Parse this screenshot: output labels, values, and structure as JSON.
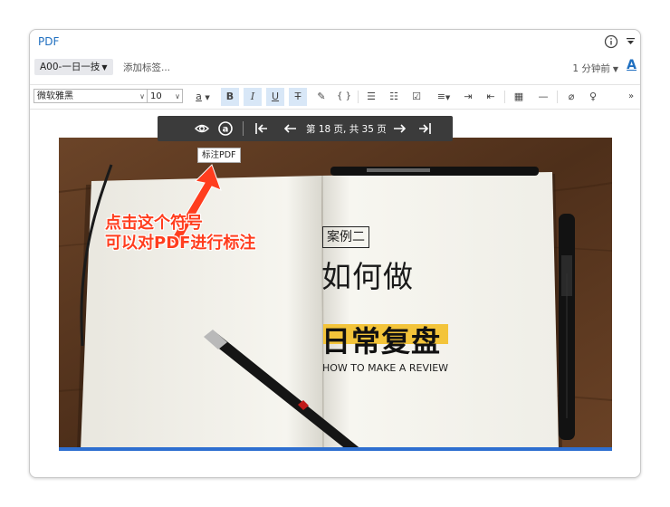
{
  "window": {
    "title": "PDF"
  },
  "tagbar": {
    "notebook": "A00-一日一技",
    "add_tag": "添加标签...",
    "time": "1 分钟前"
  },
  "toolbar": {
    "font_family": "微软雅黑",
    "font_size": "10",
    "font_color_label": "a"
  },
  "pdf_toolbar": {
    "page_info": "第 18 页, 共 35 页",
    "tooltip": "标注PDF"
  },
  "callout": {
    "line1": "点击这个符号",
    "line2": "可以对PDF进行标注"
  },
  "slide": {
    "case_label": "案例二",
    "heading1": "如何做",
    "heading2": "日常复盘",
    "subtitle": "HOW TO MAKE A REVIEW"
  },
  "colors": {
    "accent": "#1f6fc0",
    "highlight": "#f3c43a",
    "callout": "#ff3d1e",
    "pdf_toolbar_bg": "#3b3b3b"
  }
}
